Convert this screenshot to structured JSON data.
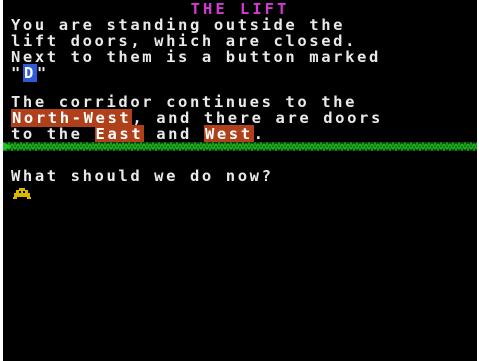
{
  "location": {
    "title": "THE LIFT"
  },
  "description": {
    "line1": "You are standing outside the",
    "line2": "lift doors, which are closed.",
    "line3": "Next to them is a button marked",
    "line4_prefix": "\"",
    "line4_key": "D",
    "line4_suffix": "\""
  },
  "exits": {
    "line1": "The corridor continues to the",
    "dir_northwest": "North-West",
    "line2_mid": ", and there are doors",
    "line3_prefix": "to the ",
    "dir_east": "East",
    "line3_and": " and ",
    "dir_west": "West",
    "line3_end": "."
  },
  "prompt": {
    "question": "What should we do now?",
    "cursor_icon": "helmet-cursor-icon"
  },
  "colors": {
    "background": "#000000",
    "text": "#e9e9e9",
    "title": "#d33ad3",
    "exit_highlight": "#b0401a",
    "key_highlight": "#2f5bd6",
    "divider_green": "#1a9a1a",
    "cursor_yellow": "#d8b800"
  }
}
